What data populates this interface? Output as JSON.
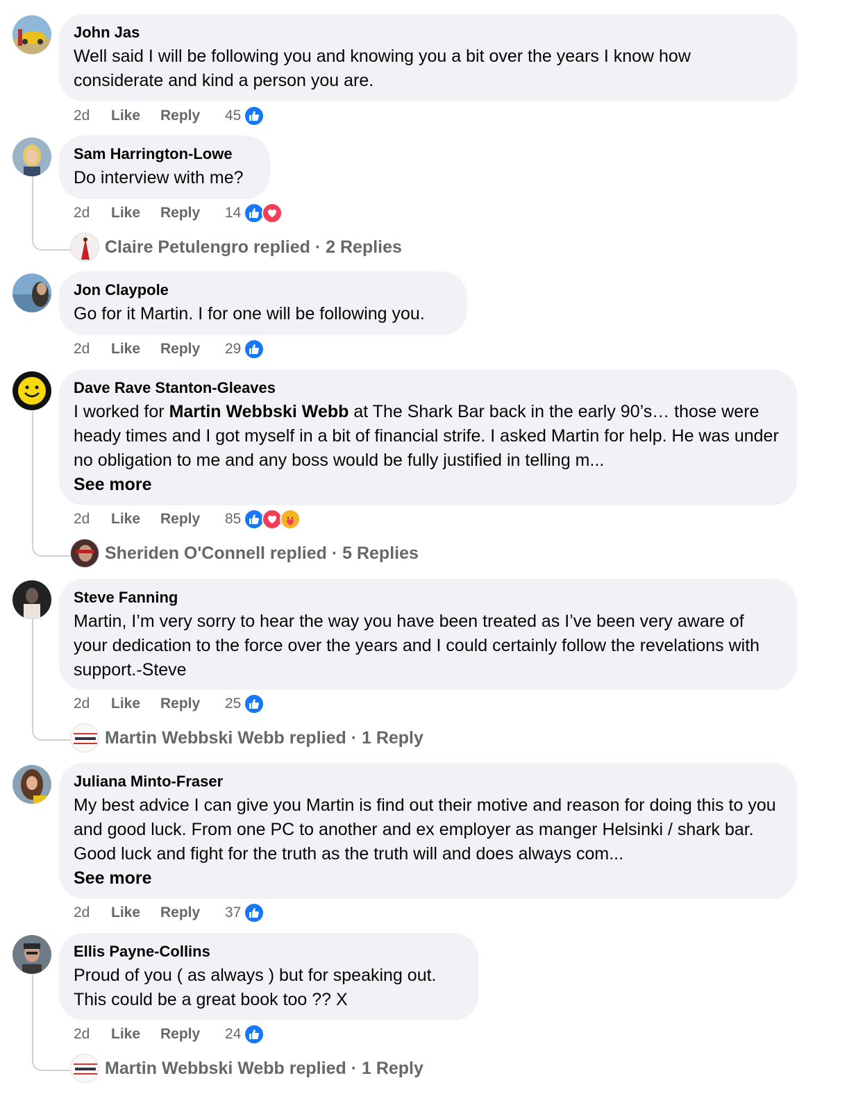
{
  "comments": [
    {
      "author": "John Jas",
      "text": "Well said I will be following you and knowing you a bit over the years I know how considerate and kind a person you are.",
      "time": "2d",
      "like": "Like",
      "reply": "Reply",
      "count": "45"
    },
    {
      "author": "Sam Harrington-Lowe",
      "text": "Do interview with me?",
      "time": "2d",
      "like": "Like",
      "reply": "Reply",
      "count": "14",
      "replied": {
        "name": "Claire Petulengro replied",
        "sep": " · ",
        "replies": "2 Replies"
      }
    },
    {
      "author": "Jon Claypole",
      "text": "Go for it Martin. I for one will be following you.",
      "time": "2d",
      "like": "Like",
      "reply": "Reply",
      "count": "29"
    },
    {
      "author": "Dave Rave Stanton-Gleaves",
      "text_pre": "I worked for ",
      "text_bold": "Martin Webbski Webb",
      "text_post": " at The Shark Bar back in the early 90’s… those were heady times and I got myself in a bit of financial strife. I asked Martin for help. He was under no obligation to me and any boss would be fully justified in telling m...",
      "see_more": "See more",
      "time": "2d",
      "like": "Like",
      "reply": "Reply",
      "count": "85",
      "replied": {
        "name": "Sheriden O'Connell replied",
        "sep": " · ",
        "replies": "5 Replies"
      }
    },
    {
      "author": "Steve Fanning",
      "text": "Martin, I’m very sorry to hear the way you have been treated as I’ve been very aware of your dedication to the force over the years and I could certainly follow the revelations with support.-Steve",
      "time": "2d",
      "like": "Like",
      "reply": "Reply",
      "count": "25",
      "replied": {
        "name": "Martin Webbski Webb replied",
        "sep": " · ",
        "replies": "1 Reply"
      }
    },
    {
      "author": "Juliana Minto-Fraser",
      "text": "My best advice I can give you Martin is find out their motive and reason for doing this to you and good luck. From one PC to another and ex employer as manger Helsinki / shark bar. Good luck and fight for the truth as the truth will and does always com...",
      "see_more": "See more",
      "time": "2d",
      "like": "Like",
      "reply": "Reply",
      "count": "37"
    },
    {
      "author": "Ellis Payne-Collins",
      "text": "Proud of you ( as always ) but for speaking out.\nThis could be a great book too ?? X",
      "time": "2d",
      "like": "Like",
      "reply": "Reply",
      "count": "24",
      "replied": {
        "name": "Martin Webbski Webb replied",
        "sep": " · ",
        "replies": "1 Reply"
      }
    }
  ],
  "reactions": {
    "like": "like-icon",
    "love": "love-icon",
    "care": "care-icon"
  },
  "colors": {
    "like_blue": "#1877f2",
    "love_red": "#f33e58",
    "care_yellow": "#f7b125",
    "bubble": "#f0f2f5",
    "meta": "#65676b"
  }
}
